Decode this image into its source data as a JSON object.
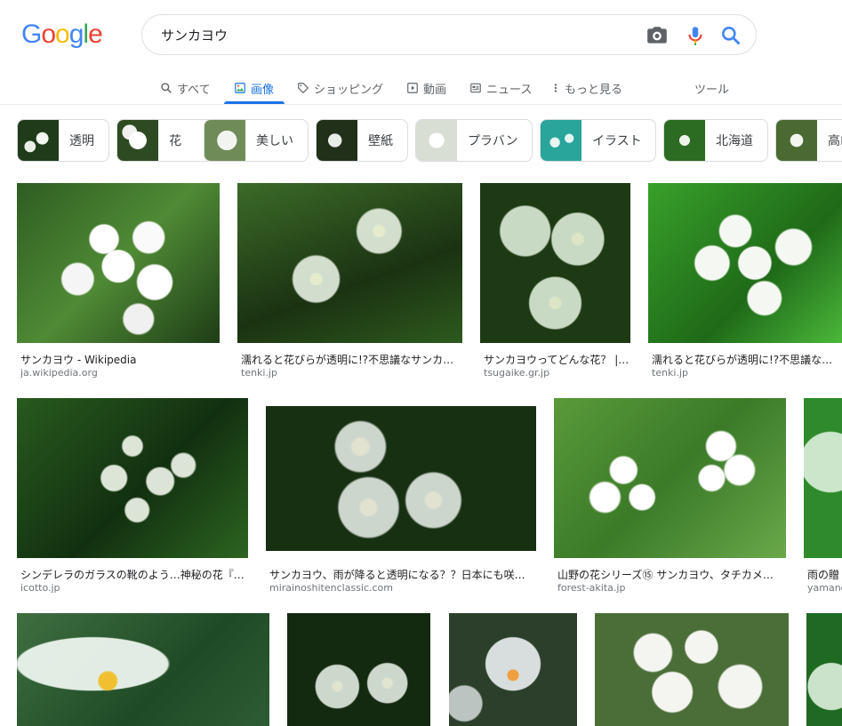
{
  "search": {
    "query": "サンカヨウ"
  },
  "logo": {
    "letters": [
      "G",
      "o",
      "o",
      "g",
      "l",
      "e"
    ],
    "colors": [
      "#4285f4",
      "#ea4335",
      "#fbbc05",
      "#4285f4",
      "#34a853",
      "#ea4335"
    ]
  },
  "tabs": [
    {
      "label": "すべて",
      "icon": "search-icon"
    },
    {
      "label": "画像",
      "icon": "image-icon",
      "active": true
    },
    {
      "label": "ショッピング",
      "icon": "tag-icon"
    },
    {
      "label": "動画",
      "icon": "play-icon"
    },
    {
      "label": "ニュース",
      "icon": "news-icon"
    },
    {
      "label": "もっと見る",
      "icon": "more-vert-icon"
    }
  ],
  "tools_label": "ツール",
  "chips": [
    {
      "label": "透明"
    },
    {
      "label": "花"
    },
    {
      "label": "美しい"
    },
    {
      "label": "壁紙"
    },
    {
      "label": "プラバン"
    },
    {
      "label": "イラスト"
    },
    {
      "label": "北海道"
    },
    {
      "label": "高山"
    }
  ],
  "results": [
    {
      "title": "サンカヨウ - Wikipedia",
      "source": "ja.wikipedia.org"
    },
    {
      "title": "濡れると花びらが透明に!?不思議なサンカ…",
      "source": "tenki.jp"
    },
    {
      "title": "サンカヨウってどんな花？ |…",
      "source": "tsugaike.gr.jp"
    },
    {
      "title": "濡れると花びらが透明に!?不思議な…",
      "source": "tenki.jp"
    },
    {
      "title": "シンデレラのガラスの靴のよう…神秘の花『…",
      "source": "icotto.jp"
    },
    {
      "title": "サンカヨウ、雨が降ると透明になる？？日本にも咲…",
      "source": "mirainoshitenclassic.com"
    },
    {
      "title": "山野の花シリーズ⑮ サンカヨウ、タチカメ…",
      "source": "forest-akita.jp"
    },
    {
      "title": "雨の贈",
      "source": "yamano"
    },
    {
      "title": "",
      "source": ""
    },
    {
      "title": "",
      "source": ""
    },
    {
      "title": "",
      "source": ""
    },
    {
      "title": "",
      "source": ""
    },
    {
      "title": "",
      "source": ""
    }
  ]
}
